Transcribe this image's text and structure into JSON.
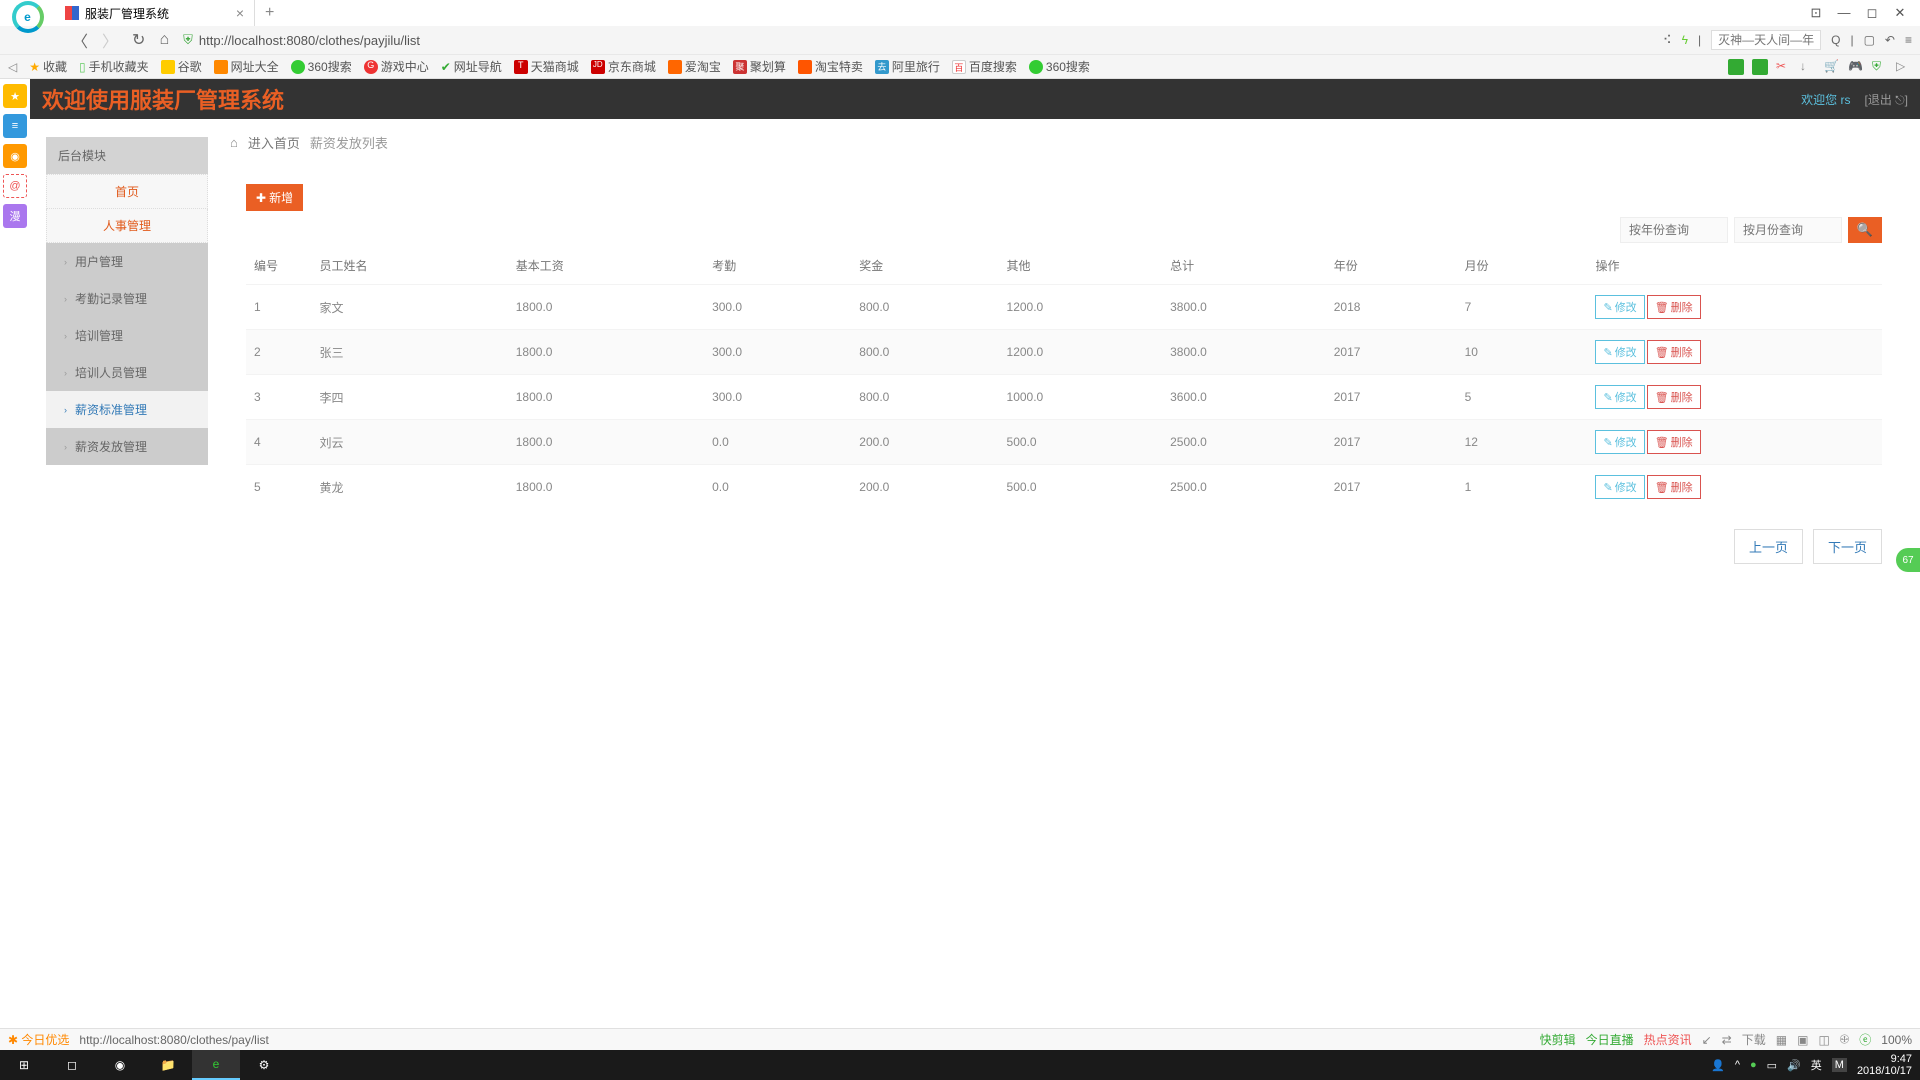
{
  "browser": {
    "tab_title": "服装厂管理系统",
    "url": "http://localhost:8080/clothes/payjilu/list",
    "search_placeholder": "灭神—天人间—年",
    "bookmarks": [
      "收藏",
      "手机收藏夹",
      "谷歌",
      "网址大全",
      "360搜索",
      "游戏中心",
      "网址导航",
      "天猫商城",
      "京东商城",
      "爱淘宝",
      "聚划算",
      "淘宝特卖",
      "阿里旅行",
      "百度搜索",
      "360搜索"
    ]
  },
  "header": {
    "title": "欢迎使用服装厂管理系统",
    "welcome": "欢迎您 rs",
    "logout": "[退出 ⎋]"
  },
  "sidebar": {
    "section": "后台模块",
    "home": "首页",
    "hr": "人事管理",
    "items": [
      "用户管理",
      "考勤记录管理",
      "培训管理",
      "培训人员管理",
      "薪资标准管理",
      "薪资发放管理"
    ],
    "active_index": 4
  },
  "breadcrumb": {
    "home": "进入首页",
    "current": "薪资发放列表"
  },
  "toolbar": {
    "add": "新增",
    "year_ph": "按年份查询",
    "month_ph": "按月份查询"
  },
  "table": {
    "headers": [
      "编号",
      "员工姓名",
      "基本工资",
      "考勤",
      "奖金",
      "其他",
      "总计",
      "年份",
      "月份",
      "操作"
    ],
    "rows": [
      {
        "id": "1",
        "name": "家文",
        "base": "1800.0",
        "att": "300.0",
        "bonus": "800.0",
        "other": "1200.0",
        "total": "3800.0",
        "year": "2018",
        "month": "7"
      },
      {
        "id": "2",
        "name": "张三",
        "base": "1800.0",
        "att": "300.0",
        "bonus": "800.0",
        "other": "1200.0",
        "total": "3800.0",
        "year": "2017",
        "month": "10"
      },
      {
        "id": "3",
        "name": "李四",
        "base": "1800.0",
        "att": "300.0",
        "bonus": "800.0",
        "other": "1000.0",
        "total": "3600.0",
        "year": "2017",
        "month": "5"
      },
      {
        "id": "4",
        "name": "刘云",
        "base": "1800.0",
        "att": "0.0",
        "bonus": "200.0",
        "other": "500.0",
        "total": "2500.0",
        "year": "2017",
        "month": "12"
      },
      {
        "id": "5",
        "name": "黄龙",
        "base": "1800.0",
        "att": "0.0",
        "bonus": "200.0",
        "other": "500.0",
        "total": "2500.0",
        "year": "2017",
        "month": "1"
      }
    ],
    "edit": "修改",
    "del": "删除"
  },
  "pagination": {
    "prev": "上一页",
    "next": "下一页"
  },
  "statusbar": {
    "jryx": "今日优选",
    "url": "http://localhost:8080/clothes/pay/list",
    "items": [
      "快剪辑",
      "今日直播",
      "热点资讯",
      "↙",
      "⇄",
      "下载",
      "▦",
      "▣",
      "◫",
      "🕀",
      "ⓔ"
    ],
    "zoom": "100%"
  },
  "taskbar": {
    "time": "9:47",
    "date": "2018/10/17",
    "ime": "英",
    "m": "M"
  },
  "float": "67"
}
